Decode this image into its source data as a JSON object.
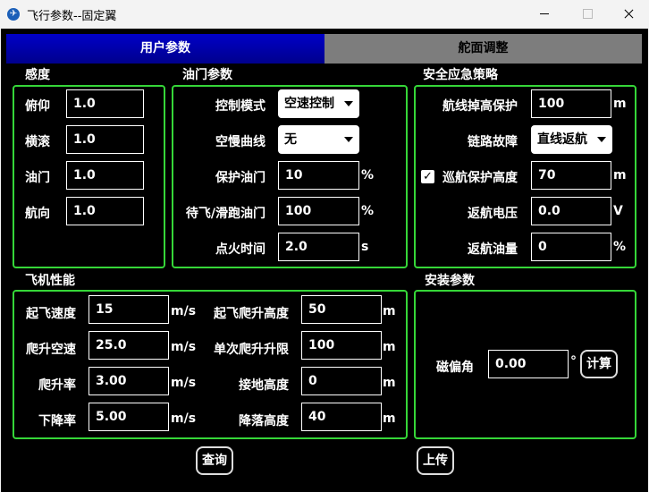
{
  "window": {
    "title": "飞行参数--固定翼"
  },
  "tabs": {
    "user_params": "用户参数",
    "rudder_adjust": "舵面调整"
  },
  "sensitivity": {
    "title": "感度",
    "pitch_label": "俯仰",
    "pitch_value": "1.0",
    "roll_label": "横滚",
    "roll_value": "1.0",
    "throttle_label": "油门",
    "throttle_value": "1.0",
    "yaw_label": "航向",
    "yaw_value": "1.0"
  },
  "throttle_params": {
    "title": "油门参数",
    "control_mode_label": "控制模式",
    "control_mode_value": "空速控制",
    "idle_curve_label": "空慢曲线",
    "idle_curve_value": "无",
    "protect_throttle_label": "保护油门",
    "protect_throttle_value": "10",
    "protect_throttle_unit": "%",
    "standby_throttle_label": "待飞/滑跑油门",
    "standby_throttle_value": "100",
    "standby_throttle_unit": "%",
    "ignition_time_label": "点火时间",
    "ignition_time_value": "2.0",
    "ignition_time_unit": "s"
  },
  "safety": {
    "title": "安全应急策略",
    "route_drop_label": "航线掉高保护",
    "route_drop_value": "100",
    "route_drop_unit": "m",
    "link_fail_label": "链路故障",
    "link_fail_value": "直线返航",
    "cruise_protect_label": "巡航保护高度",
    "cruise_protect_value": "70",
    "cruise_protect_unit": "m",
    "cruise_protect_checked": "✓",
    "return_voltage_label": "返航电压",
    "return_voltage_value": "0.0",
    "return_voltage_unit": "V",
    "return_fuel_label": "返航油量",
    "return_fuel_value": "0",
    "return_fuel_unit": "%"
  },
  "performance": {
    "title": "飞机性能",
    "takeoff_speed_label": "起飞速度",
    "takeoff_speed_value": "15",
    "takeoff_speed_unit": "m/s",
    "climb_speed_label": "爬升空速",
    "climb_speed_value": "25.0",
    "climb_speed_unit": "m/s",
    "climb_rate_label": "爬升率",
    "climb_rate_value": "3.00",
    "climb_rate_unit": "m/s",
    "descent_rate_label": "下降率",
    "descent_rate_value": "5.00",
    "descent_rate_unit": "m/s",
    "takeoff_climb_alt_label": "起飞爬升高度",
    "takeoff_climb_alt_value": "50",
    "takeoff_climb_alt_unit": "m",
    "single_climb_limit_label": "单次爬升升限",
    "single_climb_limit_value": "100",
    "single_climb_limit_unit": "m",
    "ground_alt_label": "接地高度",
    "ground_alt_value": "0",
    "ground_alt_unit": "m",
    "landing_alt_label": "降落高度",
    "landing_alt_value": "40",
    "landing_alt_unit": "m"
  },
  "install": {
    "title": "安装参数",
    "mag_decl_label": "磁偏角",
    "mag_decl_value": "0.00",
    "mag_decl_unit": "°",
    "calc_button": "计算"
  },
  "actions": {
    "query_button": "查询",
    "upload_button": "上传"
  },
  "colors": {
    "panel_border": "#35d638",
    "tab_active": "#0000c8",
    "tab_inactive": "#7d7d7d"
  }
}
